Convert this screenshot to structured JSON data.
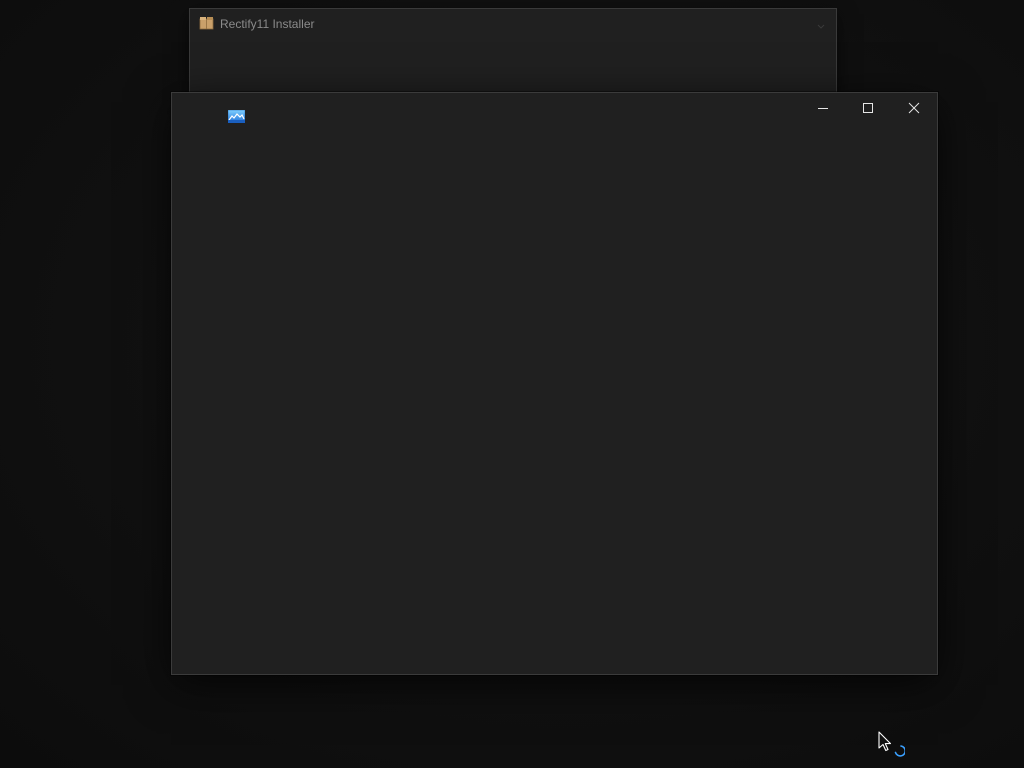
{
  "installer_window": {
    "title": "Rectify11 Installer",
    "icon": "package-icon",
    "menu_icon": "chevron-down-icon"
  },
  "main_window": {
    "icon": "app-image-icon",
    "caption_buttons": [
      "minimize-icon",
      "maximize-icon",
      "close-icon"
    ]
  },
  "cursor": {
    "state": "working-in-background",
    "icon": "busy-arrow-cursor-icon"
  },
  "colors": {
    "desktop": "#111111",
    "window_bg": "#202020",
    "window_border": "#3b3b3b",
    "caption_glyph": "#e6e6e6",
    "title_text": "#8a8a8a",
    "accent": "#3aa0ff"
  }
}
